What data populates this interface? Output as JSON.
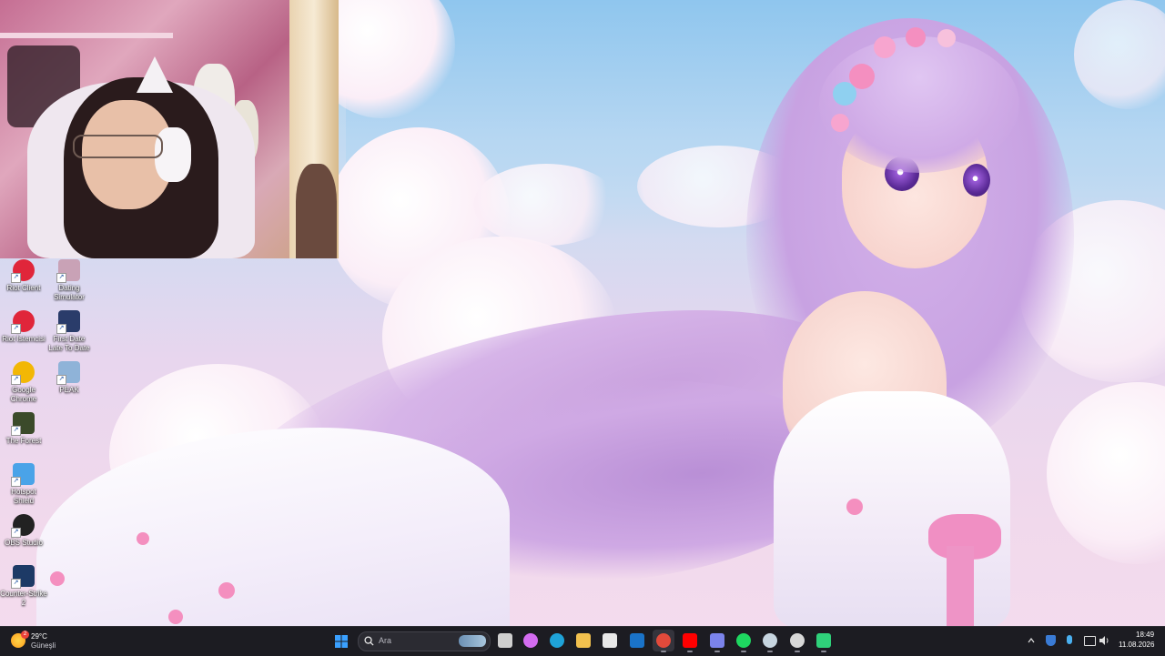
{
  "desktop_icons": [
    {
      "name": "riot-client-icon",
      "label": "Riot Client",
      "color": "#e0263a"
    },
    {
      "name": "dating-simulator-icon",
      "label": "Dating Simulator",
      "color": "#c9a2b6"
    },
    {
      "name": "riot-istemcisi-icon",
      "label": "Riot İstemcisi",
      "color": "#e0263a"
    },
    {
      "name": "first-date-icon",
      "label": "First Date Late To Date",
      "color": "#2a3c6a"
    },
    {
      "name": "google-chrome-icon",
      "label": "Google Chrome",
      "color": "#f2b705"
    },
    {
      "name": "peak-icon",
      "label": "PEAK",
      "color": "#8fb3d8"
    },
    {
      "name": "the-forest-icon",
      "label": "The Forest",
      "color": "#3b4a2a"
    },
    {
      "name": "hotspot-shield-icon",
      "label": "Hotspot Shield",
      "color": "#4aa3e8"
    },
    {
      "name": "obs-studio-icon",
      "label": "OBS Studio",
      "color": "#222"
    },
    {
      "name": "counter-strike-icon",
      "label": "Counter-Strike 2",
      "color": "#1d3a66"
    }
  ],
  "weather": {
    "badge": "2",
    "temp": "29°C",
    "condition": "Güneşli"
  },
  "search": {
    "placeholder": "Ara"
  },
  "taskbar_apps": [
    {
      "name": "start-button",
      "color": "#3aa0ff"
    },
    {
      "name": "task-view-icon",
      "color": "#cfcfcf"
    },
    {
      "name": "copilot-icon",
      "color": "#d36cf0"
    },
    {
      "name": "edge-icon",
      "color": "#1fa3d8"
    },
    {
      "name": "file-explorer-icon",
      "color": "#f2c14e"
    },
    {
      "name": "microsoft-store-icon",
      "color": "#e8e8e8"
    },
    {
      "name": "outlook-icon",
      "color": "#1a73c8"
    },
    {
      "name": "chrome-icon",
      "color": "#e24a3b"
    },
    {
      "name": "youtube-icon",
      "color": "#ff0000"
    },
    {
      "name": "teams-icon",
      "color": "#7b83eb"
    },
    {
      "name": "spotify-icon",
      "color": "#1ed760"
    },
    {
      "name": "steam-icon",
      "color": "#c7d5e0"
    },
    {
      "name": "obs-icon",
      "color": "#d8d8d8"
    },
    {
      "name": "game-launcher-icon",
      "color": "#2fd17a"
    }
  ],
  "tray": {
    "time": "18:49",
    "date": "11.08.2026"
  }
}
